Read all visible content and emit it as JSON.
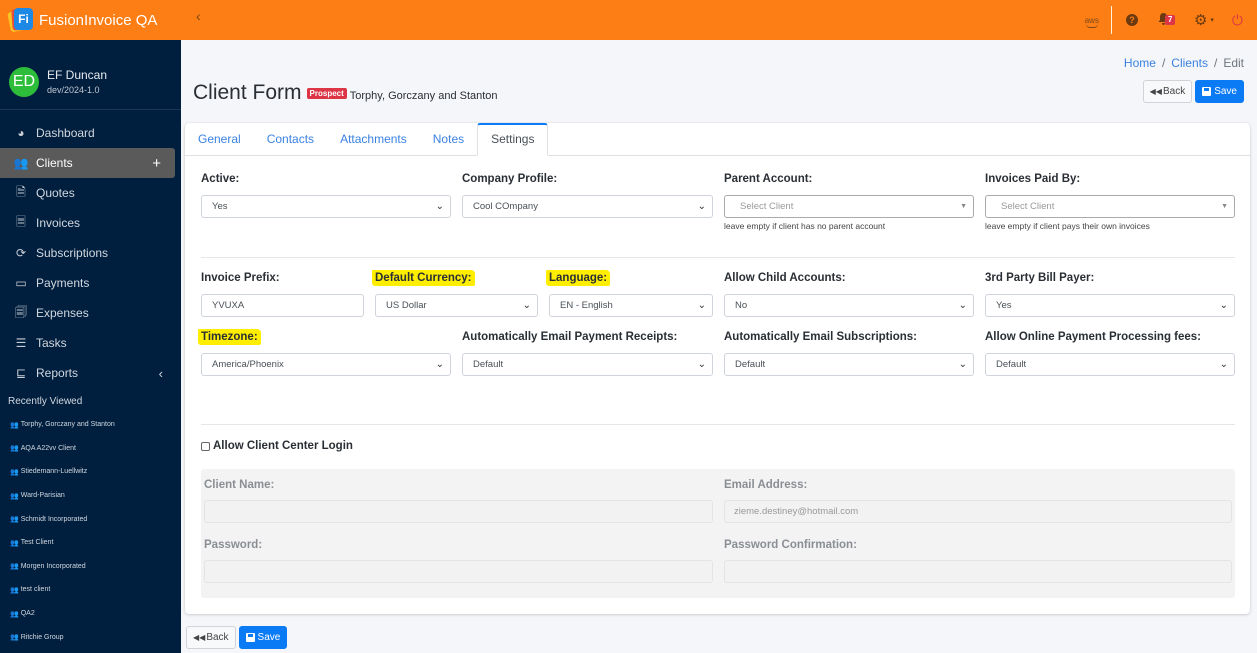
{
  "app": {
    "title": "FusionInvoice QA",
    "logo_text": "Fi",
    "icons": {
      "toggle": "‹",
      "aws": "aws",
      "help": "?",
      "bell": "🔔",
      "gear": "⚙",
      "caret": "▾",
      "power": "⏻"
    },
    "notifications_count": "7"
  },
  "user": {
    "initials": "ED",
    "name": "EF Duncan",
    "subtitle": "dev/2024-1.0"
  },
  "sidebar": {
    "items": [
      {
        "label": "Dashboard",
        "icon": "◕"
      },
      {
        "label": "Clients",
        "icon": "👥",
        "right": "+"
      },
      {
        "label": "Quotes",
        "icon": "🗎"
      },
      {
        "label": "Invoices",
        "icon": "🗏"
      },
      {
        "label": "Subscriptions",
        "icon": "⟳"
      },
      {
        "label": "Payments",
        "icon": "▭"
      },
      {
        "label": "Expenses",
        "icon": "🗐"
      },
      {
        "label": "Tasks",
        "icon": "☰"
      },
      {
        "label": "Reports",
        "icon": "⊑",
        "right": "‹"
      }
    ],
    "recent_header": "Recently Viewed",
    "recent_icon": "👥",
    "recent": [
      "Torphy, Gorczany and Stanton",
      "AQA A22vv Client",
      "Stiedemann-Luellwitz",
      "Ward-Parisian",
      "Schmidt Incorporated",
      "Test Client",
      "Morgen Incorporated",
      "test client",
      "QA2",
      "Ritchie Group"
    ]
  },
  "breadcrumb": {
    "home": "Home",
    "clients": "Clients",
    "current": "Edit",
    "sep": "/"
  },
  "page": {
    "title": "Client Form",
    "badge": "Prospect",
    "client_name": "Torphy, Gorczany and Stanton"
  },
  "actions": {
    "back_label": "Back",
    "save_label": "Save",
    "back_icon": "⏪",
    "save_icon": "💾"
  },
  "tabs": [
    {
      "label": "General"
    },
    {
      "label": "Contacts"
    },
    {
      "label": "Attachments"
    },
    {
      "label": "Notes"
    },
    {
      "label": "Settings",
      "active": true
    }
  ],
  "form": {
    "caret": "⌄",
    "select2_caret": "▼",
    "active": {
      "label": "Active:",
      "value": "Yes"
    },
    "company_profile": {
      "label": "Company Profile:",
      "value": "Cool COmpany"
    },
    "parent_account": {
      "label": "Parent Account:",
      "placeholder": "Select Client",
      "help": "leave empty if client has no parent account"
    },
    "invoices_paid_by": {
      "label": "Invoices Paid By:",
      "placeholder": "Select Client",
      "help": "leave empty if client pays their own invoices"
    },
    "invoice_prefix": {
      "label": "Invoice Prefix:",
      "value": "YVUXA"
    },
    "default_currency": {
      "label": "Default Currency:",
      "value": "US Dollar"
    },
    "language": {
      "label": "Language:",
      "value": "EN - English"
    },
    "allow_child_accounts": {
      "label": "Allow Child Accounts:",
      "value": "No"
    },
    "third_party_bill_payer": {
      "label": "3rd Party Bill Payer:",
      "value": "Yes"
    },
    "timezone": {
      "label": "Timezone:",
      "value": "America/Phoenix"
    },
    "auto_email_receipts": {
      "label": "Automatically Email Payment Receipts:",
      "value": "Default"
    },
    "auto_email_subscriptions": {
      "label": "Automatically Email Subscriptions:",
      "value": "Default"
    },
    "online_payment_fees": {
      "label": "Allow Online Payment Processing fees:",
      "value": "Default"
    },
    "client_center": {
      "checkbox_label": "Allow Client Center Login",
      "checked": false,
      "client_name": {
        "label": "Client Name:",
        "value": ""
      },
      "email": {
        "label": "Email Address:",
        "value": "zieme.destiney@hotmail.com"
      },
      "password": {
        "label": "Password:",
        "value": ""
      },
      "password_confirmation": {
        "label": "Password Confirmation:",
        "value": ""
      }
    }
  }
}
